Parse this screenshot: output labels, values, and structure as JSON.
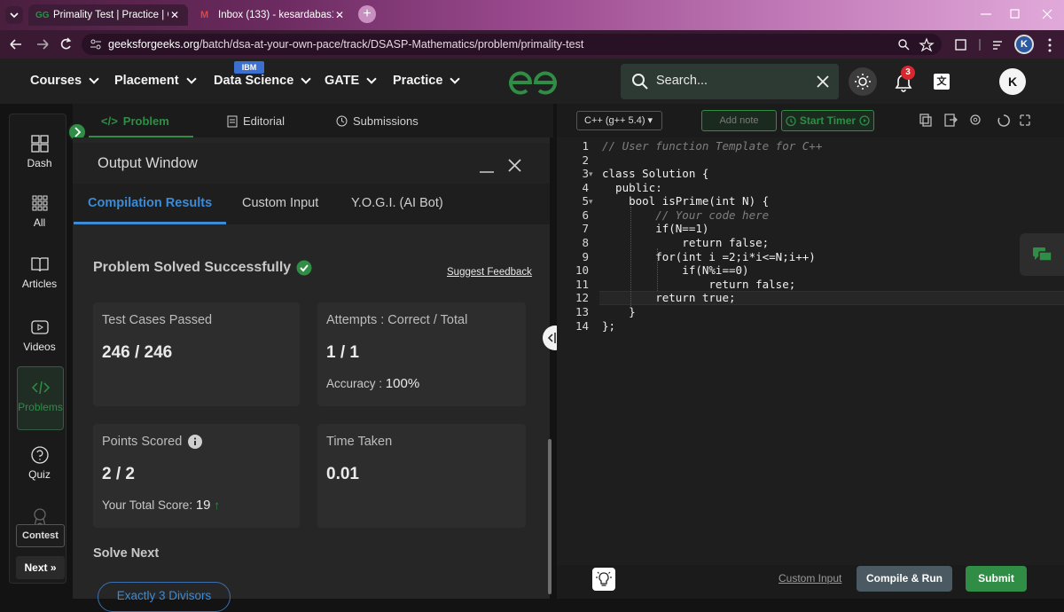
{
  "browser": {
    "tabs": [
      {
        "title": "Primality Test | Practice | GeeksforGeeks",
        "active": true
      },
      {
        "title": "Inbox (133) - kesardabas12com",
        "active": false
      }
    ],
    "url_domain": "geeksforgeeks.org",
    "url_path": "/batch/dsa-at-your-own-pace/track/DSASP-Mathematics/problem/primality-test",
    "profile_initial": "K"
  },
  "header": {
    "nav": [
      "Courses",
      "Placement",
      "Data Science",
      "GATE",
      "Practice"
    ],
    "ibm_badge": "IBM",
    "search_placeholder": "Search...",
    "notification_count": "3",
    "user_initial": "K",
    "brand_color": "#2f8d46"
  },
  "sidebar": {
    "items": [
      {
        "label": "Dash",
        "icon": "dashboard-icon"
      },
      {
        "label": "All",
        "icon": "grid-icon"
      },
      {
        "label": "Articles",
        "icon": "book-icon"
      },
      {
        "label": "Videos",
        "icon": "video-icon"
      },
      {
        "label": "Problems",
        "icon": "code-icon",
        "active": true
      },
      {
        "label": "Quiz",
        "icon": "question-icon"
      },
      {
        "label": "Contest",
        "icon": "trophy-icon"
      }
    ],
    "contest_overlap_label": "Go Back",
    "next_label": "Next"
  },
  "problem_tabs": [
    {
      "label": "Problem",
      "icon": "code-icon",
      "active": true
    },
    {
      "label": "Editorial",
      "icon": "document-icon"
    },
    {
      "label": "Submissions",
      "icon": "clock-icon"
    }
  ],
  "output_window": {
    "title": "Output Window",
    "tabs": [
      "Compilation Results",
      "Custom Input",
      "Y.O.G.I. (AI Bot)"
    ],
    "status": "Problem Solved Successfully",
    "suggest_feedback": "Suggest Feedback",
    "cards": {
      "test_cases_label": "Test Cases Passed",
      "test_cases_value": "246 / 246",
      "attempts_label": "Attempts : Correct / Total",
      "attempts_value": "1 / 1",
      "accuracy_label": "Accuracy :",
      "accuracy_value": "100%",
      "points_label": "Points Scored",
      "points_value": "2 / 2",
      "total_score_label": "Your Total Score:",
      "total_score_value": "19",
      "time_label": "Time Taken",
      "time_value": "0.01"
    },
    "solve_next_label": "Solve Next",
    "solve_next_chip": "Exactly 3 Divisors"
  },
  "editor": {
    "language": "C++ (g++ 5.4)",
    "add_note": "Add note",
    "start_timer": "Start Timer",
    "line_numbers": [
      "1",
      "2",
      "3",
      "4",
      "5",
      "6",
      "7",
      "8",
      "9",
      "10",
      "11",
      "12",
      "13",
      "14"
    ],
    "code_lines": [
      "// User function Template for C++",
      "",
      "class Solution {",
      "  public:",
      "    bool isPrime(int N) {",
      "        // Your code here",
      "        if(N==1)",
      "            return false;",
      "        for(int i =2;i*i<=N;i++)",
      "            if(N%i==0)",
      "                return false;",
      "        return true;",
      "    }",
      "};"
    ],
    "custom_input": "Custom Input",
    "compile_run": "Compile & Run",
    "submit": "Submit"
  }
}
